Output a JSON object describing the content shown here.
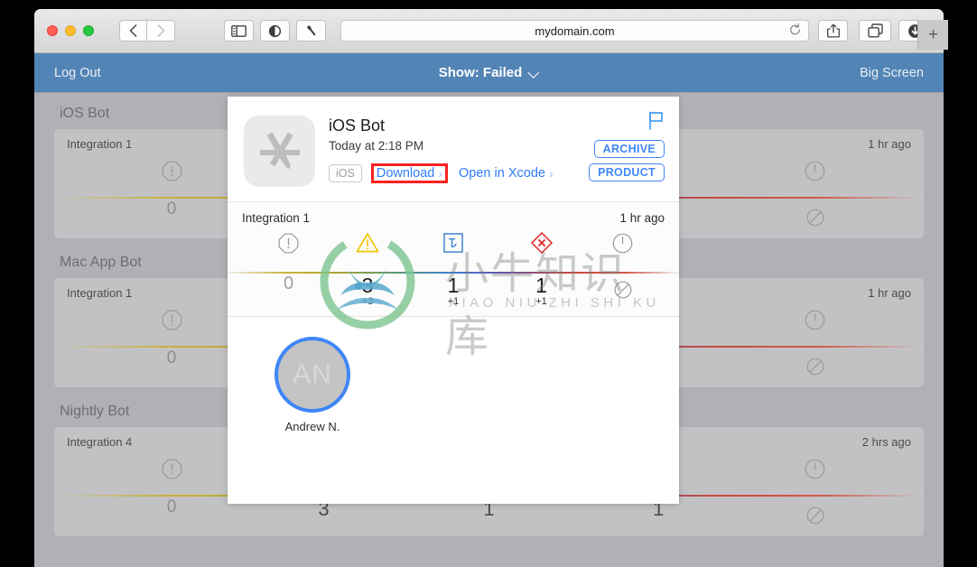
{
  "browser": {
    "url": "mydomain.com",
    "toolbar": {
      "back_icon": "chevron-left-icon",
      "forward_icon": "chevron-right-icon",
      "sidebar_icon": "sidebar-icon",
      "privacy_icon": "shield-icon",
      "flashlight_icon": "flashlight-icon",
      "reload_icon": "reload-icon",
      "share_icon": "share-icon",
      "tabs_icon": "tab-overview-icon",
      "downloads_icon": "downloads-icon",
      "new_tab_label": "+"
    }
  },
  "app_header": {
    "logout_label": "Log Out",
    "show_label": "Show: Failed",
    "big_screen_label": "Big Screen",
    "accent_color": "#5384b6"
  },
  "bots": [
    {
      "name": "iOS Bot",
      "integration": "Integration 1",
      "time": "1 hr ago",
      "metrics": [
        {
          "icon": "octagon-error-icon",
          "value": "0",
          "delta": "",
          "dim": true
        },
        {
          "icon": "warning-triangle-icon",
          "value": "",
          "delta": "",
          "dim": false
        },
        {
          "icon": "test-icon",
          "value": "",
          "delta": "",
          "dim": false
        },
        {
          "icon": "diamond-error-icon",
          "value": "",
          "delta": "",
          "dim": false
        },
        {
          "icon": "clock-icon",
          "value": "",
          "delta": "",
          "dim": true
        },
        {
          "icon": "prohibited-icon",
          "value": "",
          "delta": "",
          "dim": true
        }
      ]
    },
    {
      "name": "Mac App Bot",
      "integration": "Integration 1",
      "time": "1 hr ago",
      "metrics": [
        {
          "icon": "octagon-error-icon",
          "value": "0",
          "delta": "",
          "dim": true
        },
        {
          "icon": "warning-triangle-icon",
          "value": "",
          "delta": "",
          "dim": false
        },
        {
          "icon": "test-icon",
          "value": "",
          "delta": "",
          "dim": false
        },
        {
          "icon": "diamond-error-icon",
          "value": "",
          "delta": "",
          "dim": false
        },
        {
          "icon": "clock-icon",
          "value": "",
          "delta": "",
          "dim": true
        },
        {
          "icon": "prohibited-icon",
          "value": "",
          "delta": "",
          "dim": true
        }
      ]
    },
    {
      "name": "Nightly Bot",
      "integration": "Integration 4",
      "time": "2 hrs ago",
      "metrics": [
        {
          "icon": "octagon-error-icon",
          "value": "0",
          "delta": "",
          "dim": true
        },
        {
          "icon": "warning-triangle-icon",
          "value": "3",
          "delta": "",
          "dim": false
        },
        {
          "icon": "test-icon",
          "value": "1",
          "delta": "",
          "dim": false
        },
        {
          "icon": "diamond-error-icon",
          "value": "1",
          "delta": "",
          "dim": false
        },
        {
          "icon": "clock-icon",
          "value": "",
          "delta": "",
          "dim": true
        },
        {
          "icon": "prohibited-icon",
          "value": "",
          "delta": "",
          "dim": true
        }
      ]
    }
  ],
  "modal": {
    "app_icon": "app-store-icon",
    "title": "iOS Bot",
    "subtitle": "Today at 2:18 PM",
    "os_badge": "iOS",
    "download_label": "Download",
    "xcode_label": "Open in Xcode",
    "flag_icon": "flag-icon",
    "archive_label": "ARCHIVE",
    "product_label": "PRODUCT",
    "highlight_color": "#fc2121",
    "link_color": "#2f7cf6",
    "integration": {
      "label": "Integration 1",
      "time": "1 hr ago",
      "metrics": [
        {
          "icon": "octagon-error-icon",
          "value": "0",
          "delta": "",
          "dim": true
        },
        {
          "icon": "warning-triangle-icon",
          "value": "3",
          "delta": "+3",
          "dim": false
        },
        {
          "icon": "test-icon",
          "value": "1",
          "delta": "+1",
          "dim": false
        },
        {
          "icon": "diamond-error-icon",
          "value": "1",
          "delta": "+1",
          "dim": false
        },
        {
          "icon": "clock-icon",
          "value": "",
          "delta": "",
          "dim": true
        },
        {
          "icon": "prohibited-icon",
          "value": "",
          "delta": "",
          "dim": true
        }
      ]
    },
    "contributor": {
      "initials": "AN",
      "name": "Andrew N."
    }
  },
  "watermark": {
    "text": "小牛知识库",
    "subtext": "XIAO NIU ZHI SHI KU",
    "logo_icon": "niu-logo-icon"
  }
}
